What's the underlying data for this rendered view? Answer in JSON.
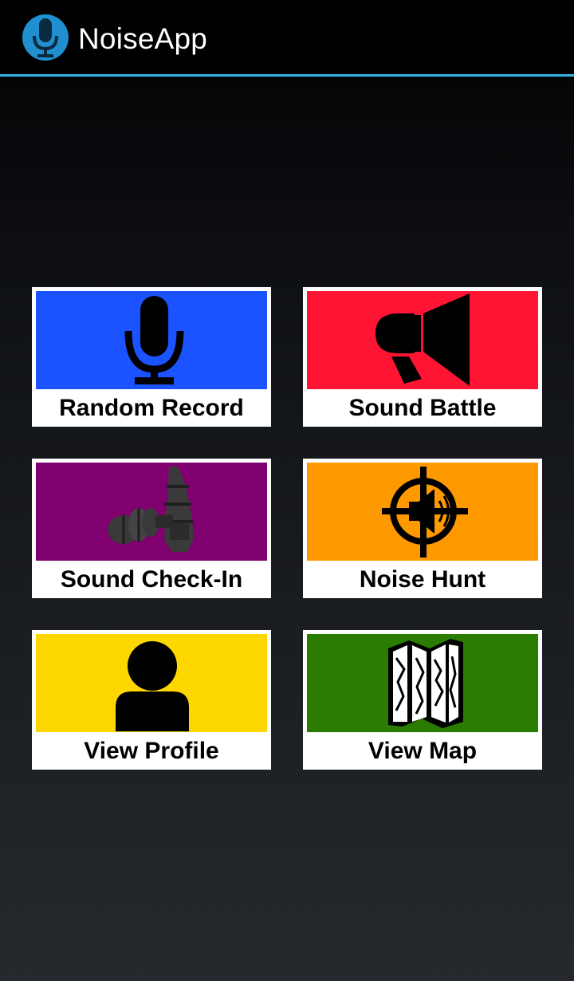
{
  "action_bar": {
    "title": "NoiseApp",
    "icon": "microphone-icon",
    "accent_color": "#33b5e5"
  },
  "tiles": [
    {
      "label": "Random Record",
      "icon": "microphone-icon",
      "color": "#1a53ff"
    },
    {
      "label": "Sound Battle",
      "icon": "megaphone-icon",
      "color": "#ff1433"
    },
    {
      "label": "Sound Check-In",
      "icon": "earplugs-icon",
      "color": "#800070"
    },
    {
      "label": "Noise Hunt",
      "icon": "crosshair-speaker-icon",
      "color": "#ff9900"
    },
    {
      "label": "View Profile",
      "icon": "person-icon",
      "color": "#ffd700"
    },
    {
      "label": "View Map",
      "icon": "folded-map-icon",
      "color": "#2a7d00"
    }
  ]
}
